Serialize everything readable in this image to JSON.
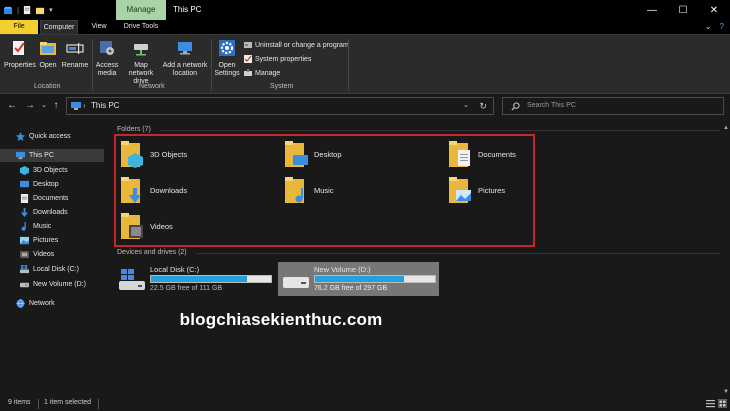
{
  "window": {
    "title": "This PC",
    "manage_tab": "Manage",
    "minimize": "—",
    "maximize": "☐",
    "close": "✕"
  },
  "tabs": {
    "file": "File",
    "computer": "Computer",
    "view": "View",
    "drive_tools": "Drive Tools"
  },
  "ribbon": {
    "location": {
      "label": "Location",
      "properties": "Properties",
      "open": "Open",
      "rename": "Rename"
    },
    "network": {
      "label": "Network",
      "access_media": "Access media",
      "map_network_drive": "Map network drive",
      "add_network_location": "Add a network location"
    },
    "system": {
      "label": "System",
      "open_settings": "Open Settings",
      "uninstall": "Uninstall or change a program",
      "system_properties": "System properties",
      "manage": "Manage"
    }
  },
  "address": {
    "path": "This PC",
    "search_placeholder": "Search This PC"
  },
  "sidebar": {
    "quick_access": "Quick access",
    "this_pc": "This PC",
    "items": [
      "3D Objects",
      "Desktop",
      "Documents",
      "Downloads",
      "Music",
      "Pictures",
      "Videos",
      "Local Disk (C:)",
      "New Volume (D:)"
    ],
    "network": "Network"
  },
  "folders": {
    "header": "Folders (7)",
    "items": [
      "3D Objects",
      "Desktop",
      "Documents",
      "Downloads",
      "Music",
      "Pictures",
      "Videos"
    ]
  },
  "drives": {
    "header": "Devices and drives (2)",
    "items": [
      {
        "name": "Local Disk (C:)",
        "free": "22.5 GB free of 111 GB",
        "used_fraction": 0.8
      },
      {
        "name": "New Volume (D:)",
        "free": "76.2 GB free of 297 GB",
        "used_fraction": 0.74
      }
    ]
  },
  "watermark": "blogchiasekienthuc.com",
  "status": {
    "items": "9 items",
    "selected": "1 item selected"
  },
  "colors": {
    "file_tab": "#f3cf2f",
    "manage_tab": "#a8d4a8",
    "progress": "#26a0da",
    "highlight_border": "#c9262c",
    "folder_yellow": "#f6d776"
  }
}
